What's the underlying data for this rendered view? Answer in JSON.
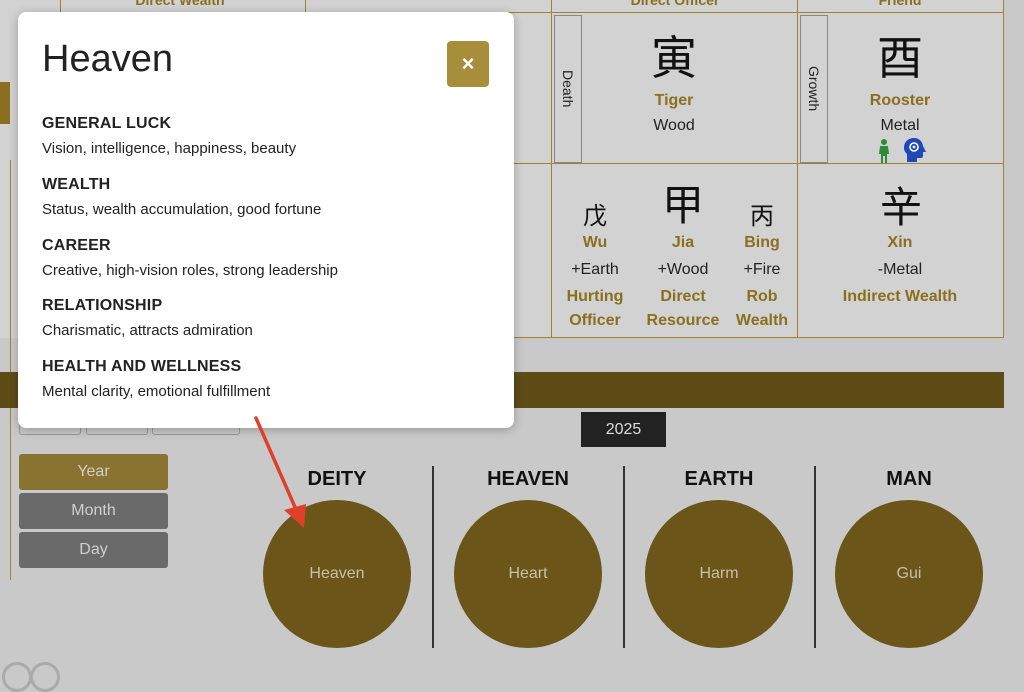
{
  "chart_top": {
    "col1_heading": "Direct Wealth",
    "col2_heading": "Direct Officer",
    "col3_heading": "Friend"
  },
  "branches": [
    {
      "side": "Death",
      "char": "寅",
      "animal": "Tiger",
      "element": "Wood"
    },
    {
      "side": "Growth",
      "char": "酉",
      "animal": "Rooster",
      "element": "Metal"
    }
  ],
  "stems_left": [
    {
      "char": "戊",
      "name": "Wu",
      "element": "+Earth",
      "god1": "Hurting",
      "god2": "Officer"
    },
    {
      "char": "甲",
      "name": "Jia",
      "element": "+Wood",
      "god1": "Direct",
      "god2": "Resource"
    },
    {
      "char": "丙",
      "name": "Bing",
      "element": "+Fire",
      "god1": "Rob",
      "god2": "Wealth"
    }
  ],
  "stem_right": {
    "char": "辛",
    "name": "Xin",
    "element": "-Metal",
    "god": "Indirect Wealth"
  },
  "year_badge": "2025",
  "side_buttons": [
    "Year",
    "Month",
    "Day"
  ],
  "columns": [
    {
      "heading": "DEITY",
      "circle": "Heaven"
    },
    {
      "heading": "HEAVEN",
      "circle": "Heart"
    },
    {
      "heading": "EARTH",
      "circle": "Harm"
    },
    {
      "heading": "MAN",
      "circle": "Gui"
    }
  ],
  "modal": {
    "title": "Heaven",
    "close_label": "×",
    "sections": [
      {
        "heading": "GENERAL LUCK",
        "text": "Vision, intelligence, happiness, beauty"
      },
      {
        "heading": "WEALTH",
        "text": "Status, wealth accumulation, good fortune"
      },
      {
        "heading": "CAREER",
        "text": "Creative, high-vision roles, strong leadership"
      },
      {
        "heading": "RELATIONSHIP",
        "text": "Charismatic, attracts admiration"
      },
      {
        "heading": "HEALTH AND WELLNESS",
        "text": "Mental clarity, emotional fulfillment"
      }
    ]
  },
  "colors": {
    "gold": "#a88e3a",
    "dark_gold": "#5e4c17",
    "circle": "#6b5519",
    "arrow": "#e0402a"
  },
  "icons": [
    "person-icon",
    "head-gear-icon",
    "red-arrow-annotation"
  ]
}
